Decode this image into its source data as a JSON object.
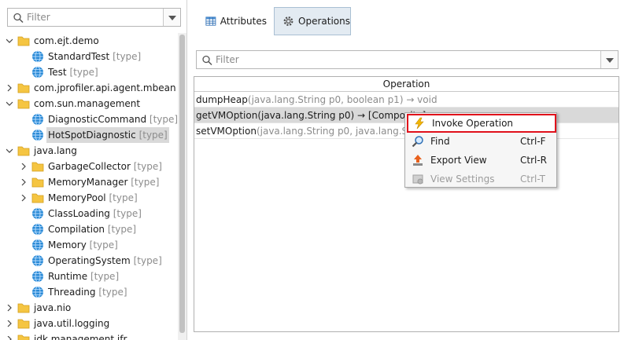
{
  "left_filter": {
    "placeholder": "Filter"
  },
  "tree": [
    {
      "label": "com.ejt.demo",
      "type": ""
    },
    {
      "label": "StandardTest",
      "type": "[type]"
    },
    {
      "label": "Test",
      "type": "[type]"
    },
    {
      "label": "com.jprofiler.api.agent.mbean",
      "type": ""
    },
    {
      "label": "com.sun.management",
      "type": ""
    },
    {
      "label": "DiagnosticCommand",
      "type": "[type]"
    },
    {
      "label": "HotSpotDiagnostic",
      "type": "[type]"
    },
    {
      "label": "java.lang",
      "type": ""
    },
    {
      "label": "GarbageCollector",
      "type": "[type]"
    },
    {
      "label": "MemoryManager",
      "type": "[type]"
    },
    {
      "label": "MemoryPool",
      "type": "[type]"
    },
    {
      "label": "ClassLoading",
      "type": "[type]"
    },
    {
      "label": "Compilation",
      "type": "[type]"
    },
    {
      "label": "Memory",
      "type": "[type]"
    },
    {
      "label": "OperatingSystem",
      "type": "[type]"
    },
    {
      "label": "Runtime",
      "type": "[type]"
    },
    {
      "label": "Threading",
      "type": "[type]"
    },
    {
      "label": "java.nio",
      "type": ""
    },
    {
      "label": "java.util.logging",
      "type": ""
    },
    {
      "label": "jdk.management.jfr",
      "type": ""
    }
  ],
  "tabs": {
    "attributes": "Attributes",
    "operations": "Operations"
  },
  "ops_filter": {
    "placeholder": "Filter"
  },
  "table": {
    "header": "Operation",
    "rows": [
      {
        "name": "dumpHeap",
        "sig": "(java.lang.String p0, boolean p1) → void"
      },
      {
        "name": "getVMOption(java.lang.String p0) → [Composite]",
        "sig": ""
      },
      {
        "name": "setVMOption",
        "sig": "(java.lang.String p0, java.lang.String p1) → void"
      }
    ]
  },
  "context_menu": {
    "invoke": "Invoke Operation",
    "find": "Find",
    "find_accel": "Ctrl-F",
    "export": "Export View",
    "export_accel": "Ctrl-R",
    "settings": "View Settings",
    "settings_accel": "Ctrl-T"
  },
  "colors": {
    "highlight_border": "#e0101b",
    "selection": "#d9d9d9",
    "folder": "#f5c542",
    "globe": "#2a8ad6"
  }
}
